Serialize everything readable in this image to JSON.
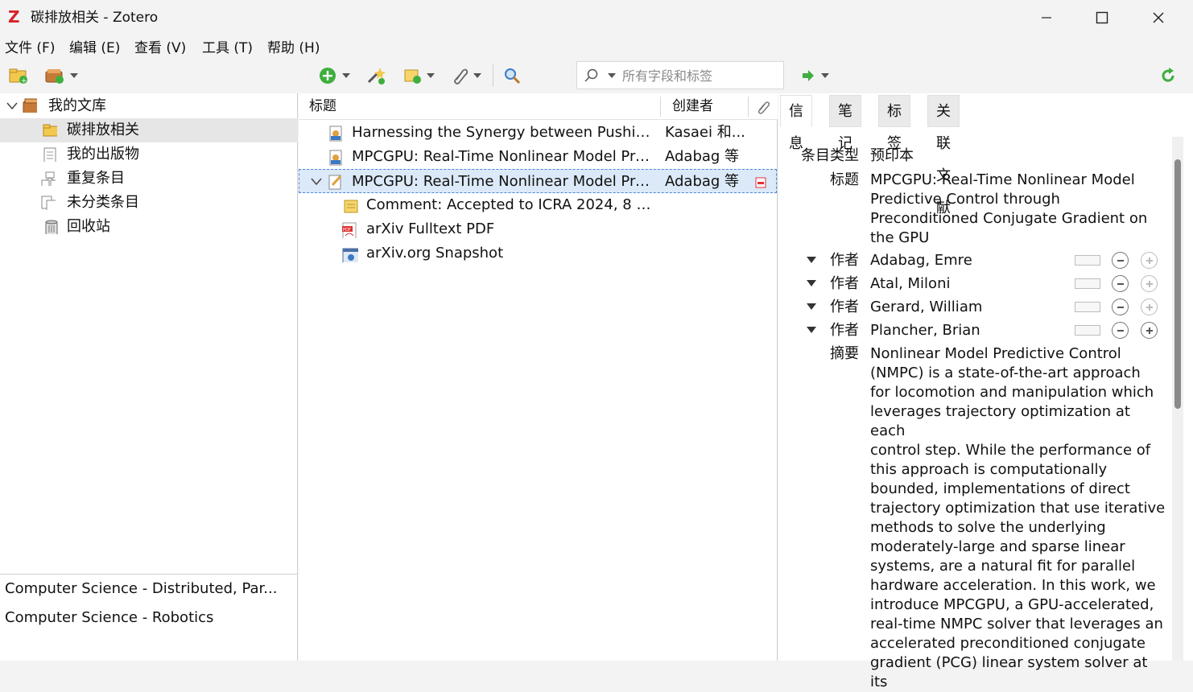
{
  "window": {
    "logo": "Z",
    "title": "碳排放相关 - Zotero",
    "minimize_icon": "minimize-icon",
    "maximize_icon": "maximize-icon",
    "close_icon": "close-icon"
  },
  "menu": {
    "file": "文件 (F)",
    "edit": "编辑 (E)",
    "view": "查看 (V)",
    "tools": "工具 (T)",
    "help": "帮助 (H)"
  },
  "toolbar": {
    "search_placeholder": "所有字段和标签",
    "search_value": ""
  },
  "collections": {
    "library": "我的文库",
    "items": [
      {
        "label": "碳排放相关",
        "selected": true
      },
      {
        "label": "我的出版物"
      },
      {
        "label": "重复条目"
      },
      {
        "label": "未分类条目"
      },
      {
        "label": "回收站"
      }
    ]
  },
  "tags": [
    "Computer Science - Distributed, Par...",
    "Computer Science - Robotics"
  ],
  "items_table": {
    "col_title": "标题",
    "col_creator": "创建者",
    "rows": [
      {
        "title": "Harnessing the Synergy between Pushing...",
        "creator": "Kasaei 和..."
      },
      {
        "title": "MPCGPU: Real-Time Nonlinear Model Pre...",
        "creator": "Adabag 等"
      },
      {
        "title": "MPCGPU: Real-Time Nonlinear Model Pre...",
        "creator": "Adabag 等",
        "selected": true
      },
      {
        "title": "Comment: Accepted to ICRA 2024, 8 pa...",
        "child": true
      },
      {
        "title": "arXiv Fulltext PDF",
        "child": true
      },
      {
        "title": "arXiv.org Snapshot",
        "child": true
      }
    ]
  },
  "item_pane": {
    "tabs": [
      "信息",
      "笔记",
      "标签",
      "关联文献"
    ],
    "item_type_label": "条目类型",
    "item_type_value": "预印本",
    "title_label": "标题",
    "title_lines": [
      "MPCGPU: Real-Time Nonlinear Model",
      "Predictive Control through",
      "Preconditioned Conjugate Gradient on",
      "the GPU"
    ],
    "creator_label": "作者",
    "creators": [
      "Adabag, Emre",
      "Atal, Miloni",
      "Gerard, William",
      "Plancher, Brian"
    ],
    "abstract_label": "摘要",
    "abstract_lines": [
      "Nonlinear Model Predictive Control",
      "(NMPC) is a state-of-the-art approach",
      "for locomotion and manipulation which",
      "leverages trajectory optimization at each",
      "control step. While the performance of",
      "this approach is computationally",
      "bounded, implementations of direct",
      "trajectory optimization that use iterative",
      "methods to solve the underlying",
      "moderately-large and sparse linear",
      "systems, are a natural fit for parallel",
      "hardware acceleration. In this work, we",
      "introduce MPCGPU, a GPU-accelerated,",
      "real-time NMPC solver that leverages an",
      "accelerated preconditioned conjugate",
      "gradient (PCG) linear system solver at its"
    ]
  }
}
